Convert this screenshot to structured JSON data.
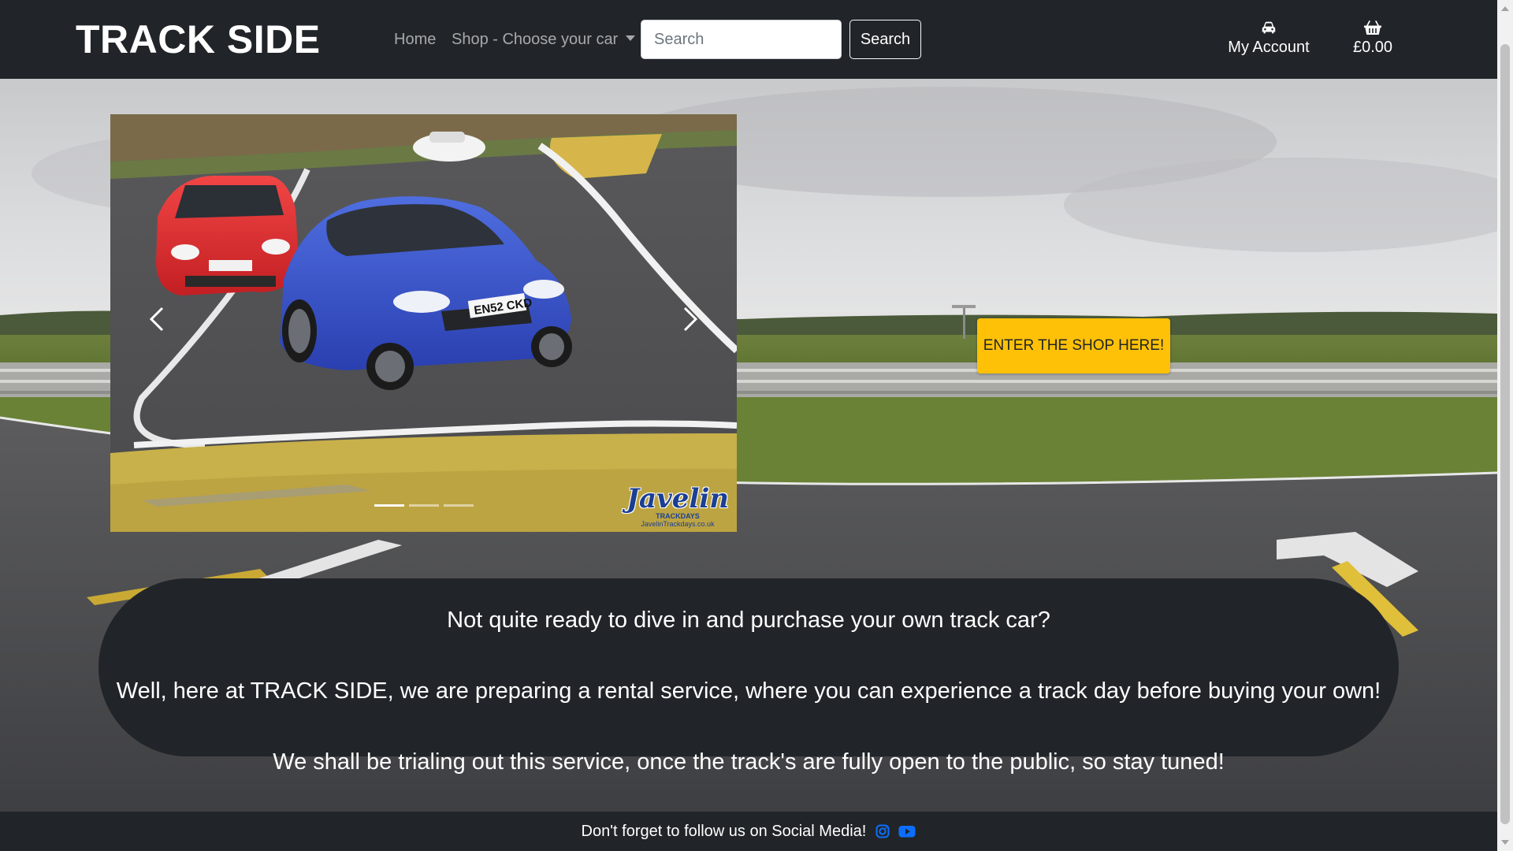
{
  "brand": {
    "name": "TRACK SIDE"
  },
  "nav": {
    "home": "Home",
    "shop": "Shop - Choose your car",
    "search_placeholder": "Search",
    "search_button": "Search"
  },
  "account": {
    "my_account": "My Account",
    "basket_total": "£0.00",
    "icons": {
      "account": "car-icon",
      "basket": "basket-icon"
    }
  },
  "carousel": {
    "slide_count": 3,
    "active_index": 0,
    "watermark": {
      "logo": "Javelin",
      "sub": "TRACKDAYS",
      "url": "JavelinTrackdays.co.uk"
    },
    "plate_blue": "EN52 CKD"
  },
  "hero": {
    "shop_button": "ENTER THE SHOP HERE!"
  },
  "info": {
    "line1": "Not quite ready to dive in and purchase your own track car?",
    "line2": "Well, here at TRACK SIDE, we are preparing a rental service, where you can experience a track day before buying your own!",
    "line3": "We shall be trialing out this service, once the track's are fully open to the public, so stay tuned!"
  },
  "footer": {
    "text": "Don't forget to follow us on Social Media!",
    "icons": [
      "instagram-icon",
      "youtube-icon"
    ]
  },
  "colors": {
    "nav_bg": "#212529",
    "accent": "#ffc107",
    "social": "#0d6efd"
  }
}
